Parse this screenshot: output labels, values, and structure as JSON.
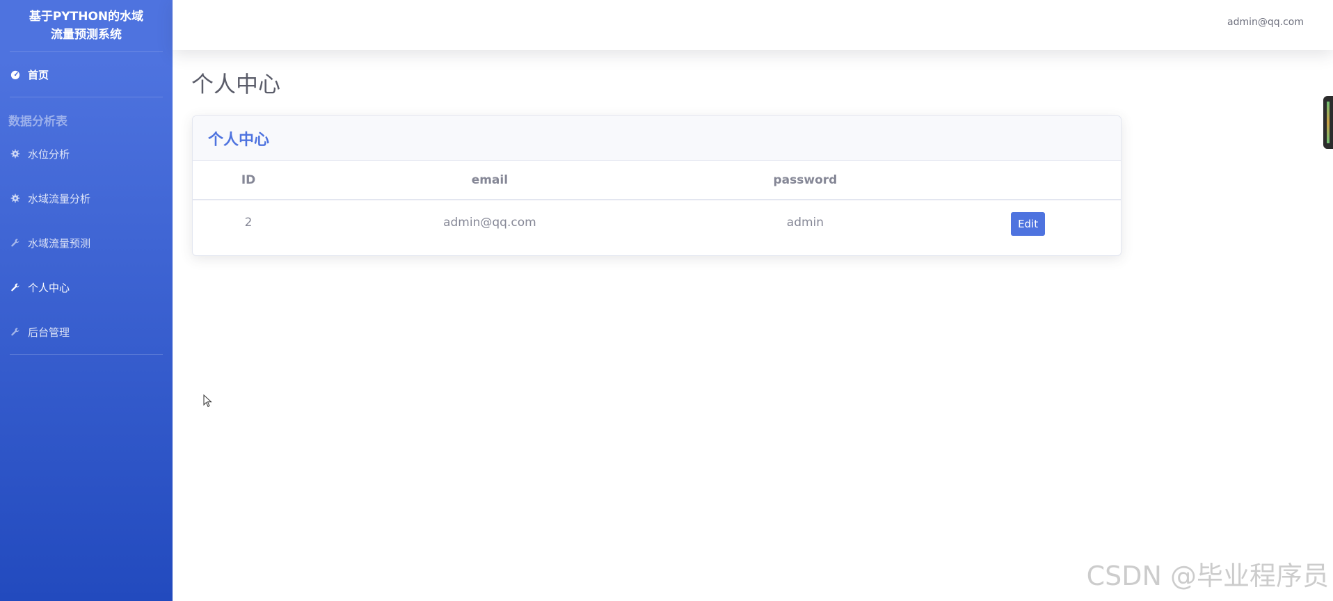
{
  "sidebar": {
    "brand_line1": "基于PYTHON的水域",
    "brand_line2": "流量预测系统",
    "home_label": "首页",
    "section_heading": "数据分析表",
    "items": [
      {
        "label": "水位分析",
        "icon": "gear-icon"
      },
      {
        "label": "水域流量分析",
        "icon": "gear-icon"
      },
      {
        "label": "水域流量预测",
        "icon": "wrench-icon"
      },
      {
        "label": "个人中心",
        "icon": "wrench-icon"
      },
      {
        "label": "后台管理",
        "icon": "wrench-icon"
      }
    ]
  },
  "topbar": {
    "user_email": "admin@qq.com"
  },
  "main": {
    "page_title": "个人中心",
    "card_title": "个人中心",
    "table": {
      "headers": [
        "ID",
        "email",
        "password",
        ""
      ],
      "rows": [
        {
          "id": "2",
          "email": "admin@qq.com",
          "password": "admin",
          "action": "Edit"
        }
      ]
    }
  },
  "watermark": "CSDN @毕业程序员",
  "colors": {
    "primary": "#4e73df",
    "primary_dark": "#224abe",
    "text_muted": "#858796"
  }
}
